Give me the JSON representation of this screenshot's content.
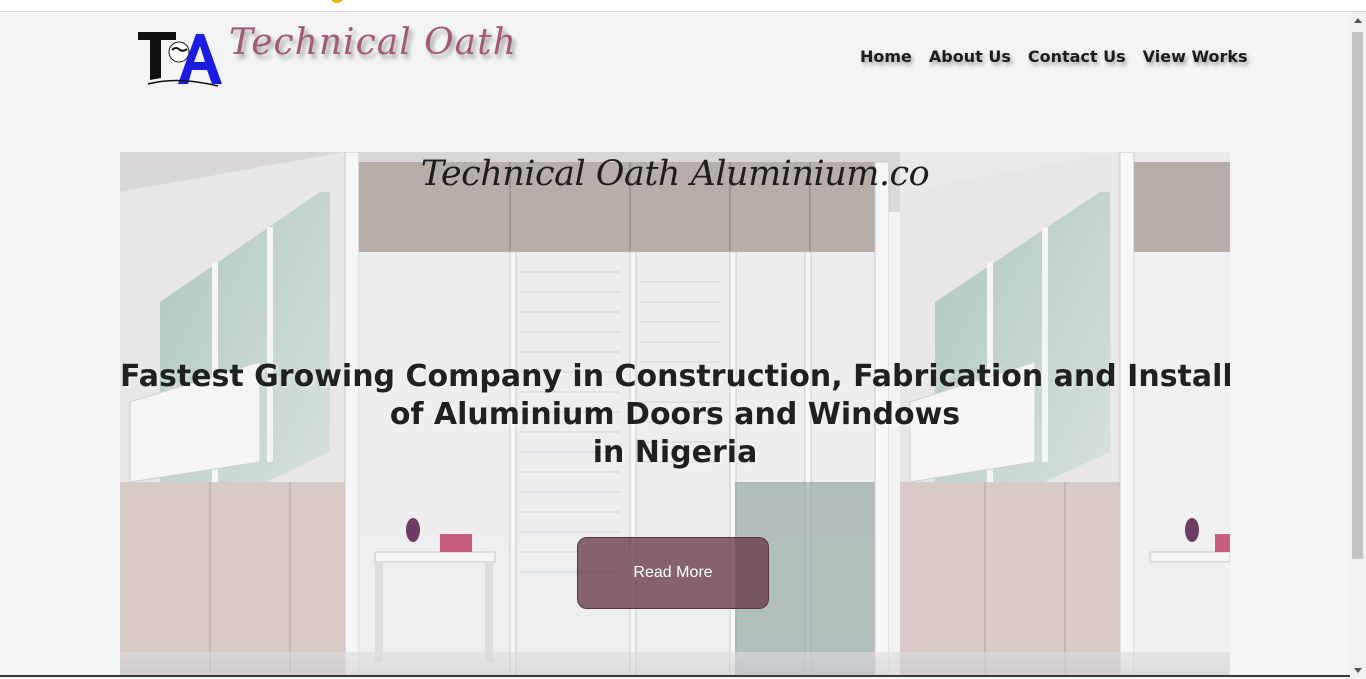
{
  "header": {
    "brand": "Technical Oath",
    "logo_text": "TA",
    "nav": [
      {
        "label": "Home"
      },
      {
        "label": "About Us"
      },
      {
        "label": "Contact Us"
      },
      {
        "label": "View Works"
      }
    ]
  },
  "hero": {
    "title": "Technical Oath Aluminium.co",
    "headline_lines": [
      "Fastest Growing Company in Construction, Fabrication and Installation",
      "of Aluminium Doors and Windows",
      "in Nigeria"
    ],
    "button_label": "Read More"
  },
  "colors": {
    "brand": "#a35c77",
    "button_bg": "#683a48",
    "page_bg": "#f3f4f6",
    "accent": "#f0b200"
  }
}
